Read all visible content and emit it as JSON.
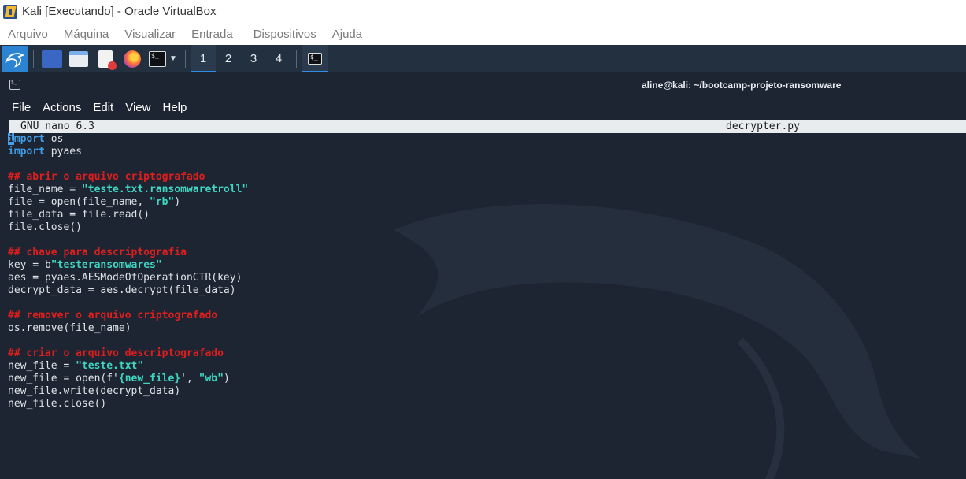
{
  "host": {
    "title": "Kali [Executando] - Oracle VirtualBox",
    "menu": [
      "Arquivo",
      "Máquina",
      "Visualizar",
      "Entrada",
      "Dispositivos",
      "Ajuda"
    ]
  },
  "panel": {
    "workspaces": [
      "1",
      "2",
      "3",
      "4"
    ],
    "active_workspace": "1",
    "icons": [
      "kali-menu-icon",
      "show-desktop-icon",
      "file-manager-icon",
      "text-editor-icon",
      "firefox-icon",
      "terminal-icon",
      "terminal-task-icon"
    ]
  },
  "terminal": {
    "title": "aline@kali: ~/bootcamp-projeto-ransomware",
    "menu": [
      "File",
      "Actions",
      "Edit",
      "View",
      "Help"
    ]
  },
  "nano": {
    "version": "GNU nano 6.3",
    "filename": "decrypter.py",
    "lines": [
      [
        {
          "t": "i",
          "c": "kw cursor"
        },
        {
          "t": "mport",
          "c": "kw"
        },
        {
          "t": " os",
          "c": ""
        }
      ],
      [
        {
          "t": "import",
          "c": "kw"
        },
        {
          "t": " pyaes",
          "c": ""
        }
      ],
      [],
      [
        {
          "t": "## abrir o arquivo criptografado",
          "c": "cm"
        }
      ],
      [
        {
          "t": "file_name = ",
          "c": ""
        },
        {
          "t": "\"teste.txt.ransomwaretroll\"",
          "c": "st"
        }
      ],
      [
        {
          "t": "file = open(file_name, ",
          "c": ""
        },
        {
          "t": "\"rb\"",
          "c": "st"
        },
        {
          "t": ")",
          "c": ""
        }
      ],
      [
        {
          "t": "file_data = file.read()",
          "c": ""
        }
      ],
      [
        {
          "t": "file.close()",
          "c": ""
        }
      ],
      [],
      [
        {
          "t": "## chave para descriptografia",
          "c": "cm"
        }
      ],
      [
        {
          "t": "key = b",
          "c": ""
        },
        {
          "t": "\"testeransomwares\"",
          "c": "st"
        }
      ],
      [
        {
          "t": "aes = pyaes.AESModeOfOperationCTR(key)",
          "c": ""
        }
      ],
      [
        {
          "t": "decrypt_data = aes.decrypt(file_data)",
          "c": ""
        }
      ],
      [],
      [
        {
          "t": "## remover o arquivo criptografado",
          "c": "cm"
        }
      ],
      [
        {
          "t": "os.remove(file_name)",
          "c": ""
        }
      ],
      [],
      [
        {
          "t": "## criar o arquivo descriptografado",
          "c": "cm"
        }
      ],
      [
        {
          "t": "new_file = ",
          "c": ""
        },
        {
          "t": "\"teste.txt\"",
          "c": "st"
        }
      ],
      [
        {
          "t": "new_file = open(f'",
          "c": ""
        },
        {
          "t": "{new_file}",
          "c": "st"
        },
        {
          "t": "', ",
          "c": ""
        },
        {
          "t": "\"wb\"",
          "c": "st"
        },
        {
          "t": ")",
          "c": ""
        }
      ],
      [
        {
          "t": "new_file.write(decrypt_data)",
          "c": ""
        }
      ],
      [
        {
          "t": "new_file.close()",
          "c": ""
        }
      ]
    ]
  },
  "colors": {
    "keyword": "#3f9ee8",
    "comment": "#e01e1e",
    "string": "#3fd7c2",
    "background": "#1e2532"
  }
}
